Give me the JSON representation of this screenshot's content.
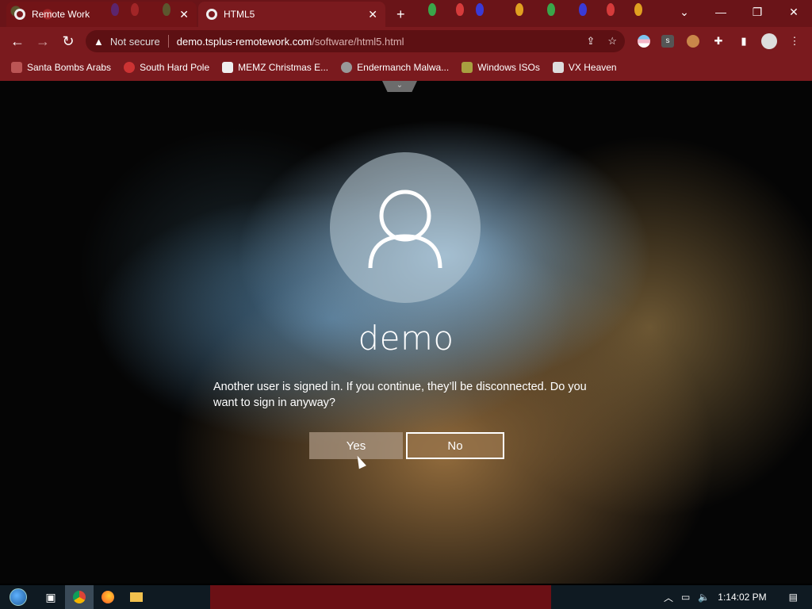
{
  "browser": {
    "tabs": [
      {
        "title": "Remote Work",
        "active": false
      },
      {
        "title": "HTML5",
        "active": true
      }
    ],
    "new_tab_label": "+",
    "window_controls": {
      "minimize": "—",
      "restore": "❐",
      "close": "✕",
      "tab_search": "⌄"
    },
    "nav": {
      "back": "←",
      "forward": "→",
      "reload": "↻"
    },
    "address_bar": {
      "security_icon": "warning-triangle-icon",
      "security_text": "Not secure",
      "host": "demo.tsplus-remotework.com",
      "path": "/software/html5.html"
    },
    "bookmarks": [
      {
        "label": "Santa Bombs Arabs",
        "icon": "bomb-icon"
      },
      {
        "label": "South Hard Pole",
        "icon": "snowflake-icon"
      },
      {
        "label": "MEMZ Christmas E...",
        "icon": "window-icon"
      },
      {
        "label": "Endermanch Malwa...",
        "icon": "raccoon-icon"
      },
      {
        "label": "Windows ISOs",
        "icon": "figure-icon"
      },
      {
        "label": "VX Heaven",
        "icon": "ghost-icon"
      }
    ]
  },
  "login_screen": {
    "username": "demo",
    "message": "Another user is signed in. If you continue, they’ll be disconnected. Do you want to sign in anyway?",
    "yes_label": "Yes",
    "no_label": "No"
  },
  "taskbar": {
    "clock": "1:14:02 PM",
    "colors": {
      "bar": "#0f1a22",
      "band": "#6b1015"
    }
  },
  "colors": {
    "chrome": "#7a1a1e",
    "omnibox": "#5d1013"
  }
}
